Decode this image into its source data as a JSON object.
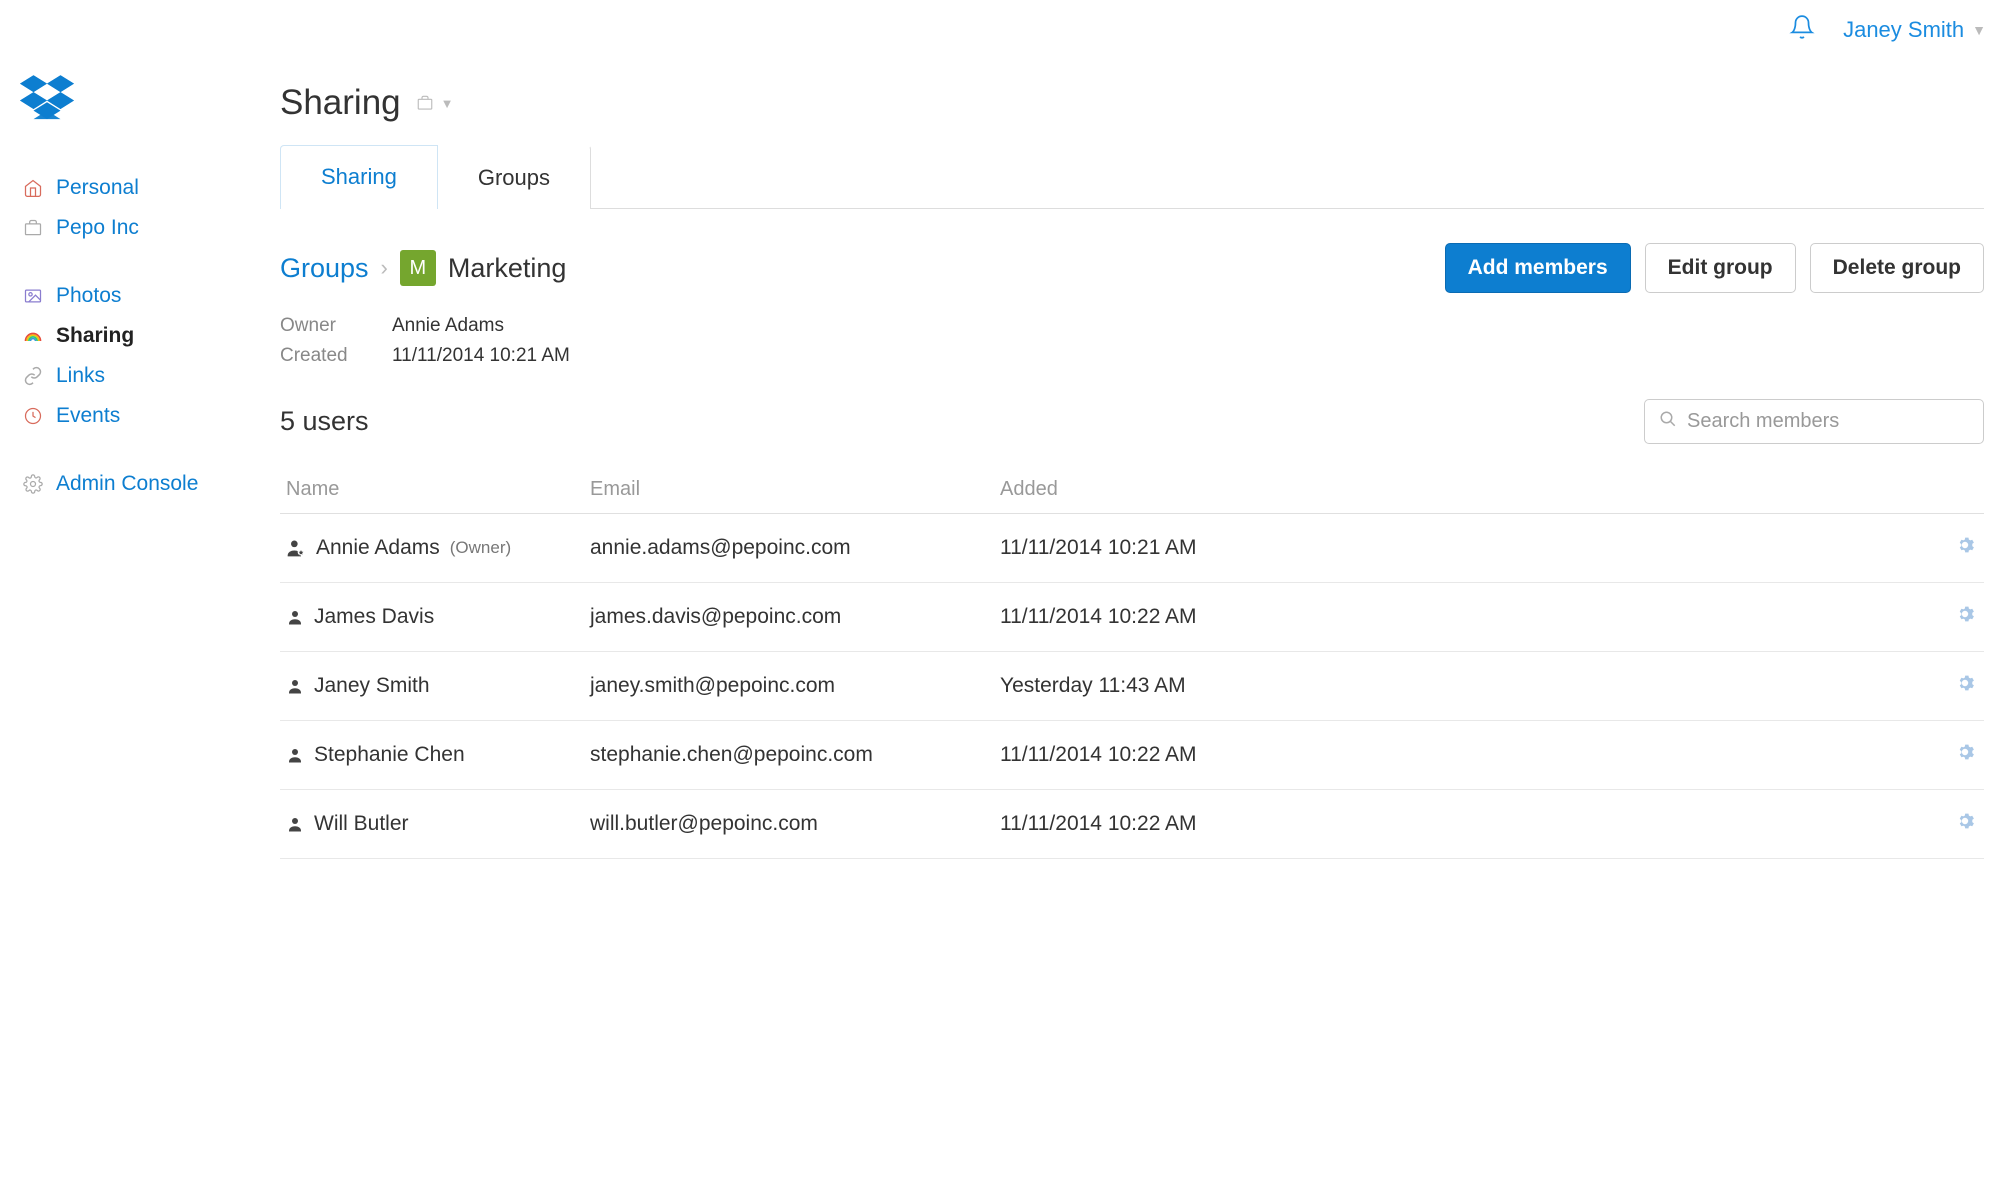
{
  "topbar": {
    "user_name": "Janey Smith"
  },
  "sidebar": {
    "company": "Pepo Inc",
    "items": {
      "personal": "Personal",
      "company": "Pepo Inc",
      "photos": "Photos",
      "sharing": "Sharing",
      "links": "Links",
      "events": "Events",
      "admin": "Admin Console"
    }
  },
  "page": {
    "title": "Sharing"
  },
  "tabs": {
    "sharing": "Sharing",
    "groups": "Groups"
  },
  "breadcrumb": {
    "groups": "Groups",
    "badge_letter": "M",
    "group_name": "Marketing"
  },
  "actions": {
    "add_members": "Add members",
    "edit_group": "Edit group",
    "delete_group": "Delete group"
  },
  "meta": {
    "owner_label": "Owner",
    "owner_value": "Annie Adams",
    "created_label": "Created",
    "created_value": "11/11/2014 10:21 AM"
  },
  "users_count": "5 users",
  "search": {
    "placeholder": "Search members"
  },
  "columns": {
    "name": "Name",
    "email": "Email",
    "added": "Added"
  },
  "owner_tag": "(Owner)",
  "members": [
    {
      "name": "Annie Adams",
      "email": "annie.adams@pepoinc.com",
      "added": "11/11/2014 10:21 AM",
      "is_owner": true
    },
    {
      "name": "James Davis",
      "email": "james.davis@pepoinc.com",
      "added": "11/11/2014 10:22 AM",
      "is_owner": false
    },
    {
      "name": "Janey Smith",
      "email": "janey.smith@pepoinc.com",
      "added": "Yesterday 11:43 AM",
      "is_owner": false
    },
    {
      "name": "Stephanie Chen",
      "email": "stephanie.chen@pepoinc.com",
      "added": "11/11/2014 10:22 AM",
      "is_owner": false
    },
    {
      "name": "Will Butler",
      "email": "will.butler@pepoinc.com",
      "added": "11/11/2014 10:22 AM",
      "is_owner": false
    }
  ]
}
